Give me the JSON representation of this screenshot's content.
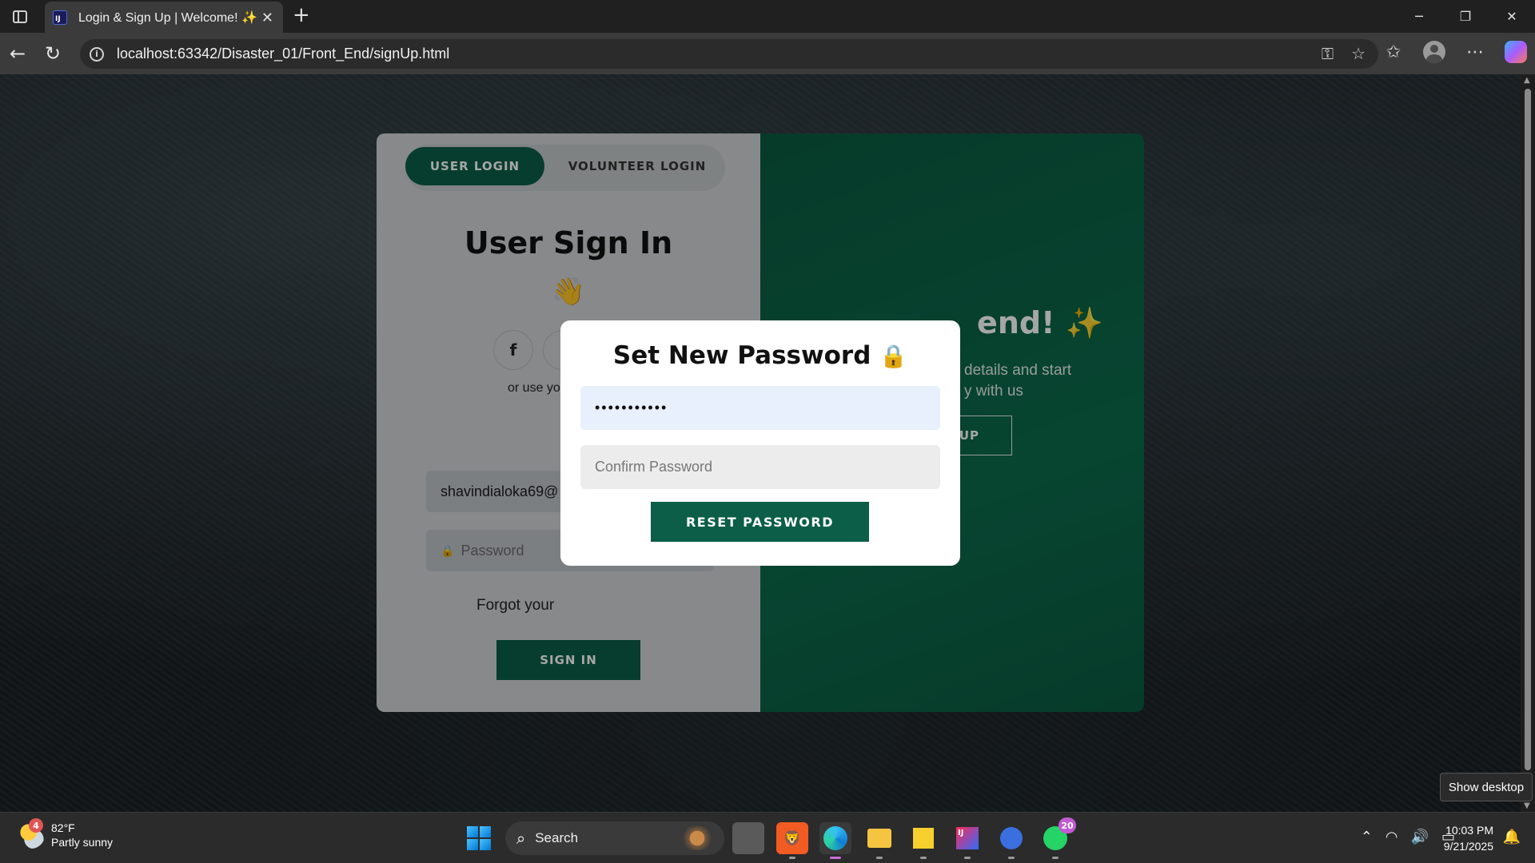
{
  "browser": {
    "tab_title": "Login & Sign Up | Welcome! ✨",
    "tab_favicon_text": "IJ",
    "url": "localhost:63342/Disaster_01/Front_End/signUp.html"
  },
  "left_panel": {
    "tabs": [
      "USER LOGIN",
      "VOLUNTEER LOGIN"
    ],
    "title": "User Sign In",
    "wave_emoji": "👋",
    "social_f": "f",
    "or_use_text": "or use yo",
    "email_value": "shavindialoka69@",
    "password_placeholder": "Password",
    "forgot_text": "Forgot your",
    "signin_label": "SIGN IN"
  },
  "right_panel": {
    "title": "end! ✨",
    "subtitle_line1": "details and start",
    "subtitle_line2": "y with us",
    "button_label": "UP"
  },
  "modal": {
    "title": "Set New Password",
    "title_icon": "🔒",
    "new_password_value": "•••••••••••",
    "confirm_placeholder": "Confirm Password",
    "reset_label": "RESET PASSWORD"
  },
  "taskbar": {
    "weather_badge": "4",
    "temperature": "82°F",
    "condition": "Partly sunny",
    "search_label": "Search",
    "whatsapp_badge": "20",
    "time": "10:03 PM",
    "date": "9/21/2025"
  },
  "tooltip": "Show desktop",
  "colors": {
    "brand_green": "#0c5e48",
    "modal_input_autofill": "#e8f0fe"
  }
}
